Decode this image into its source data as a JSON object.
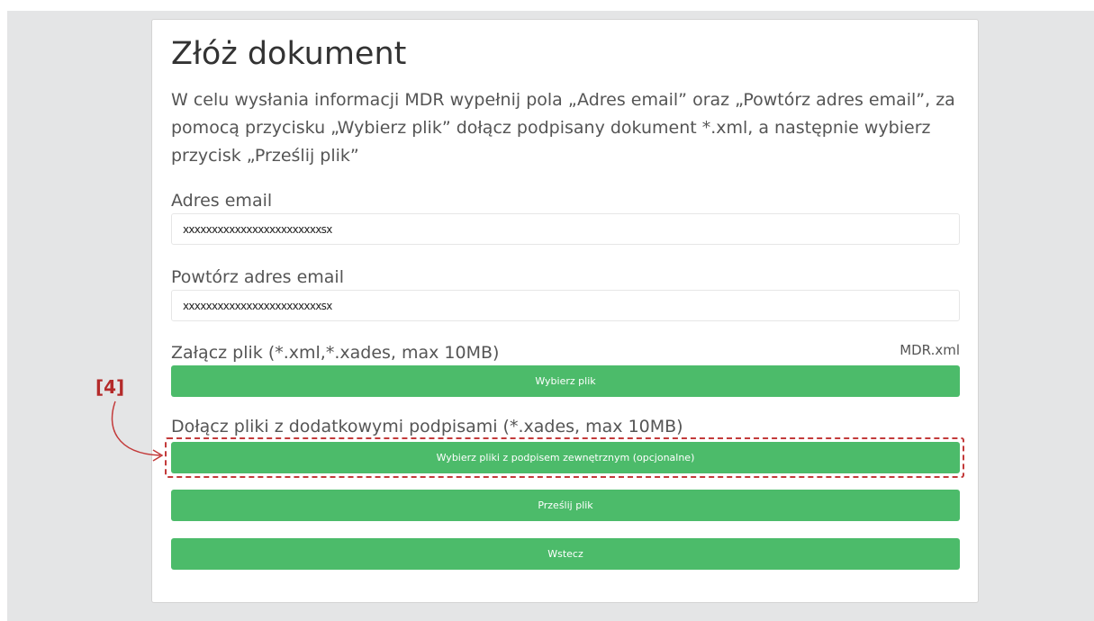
{
  "form": {
    "title": "Złóż dokument",
    "intro": "W celu wysłania informacji MDR wypełnij pola „Adres email” oraz „Powtórz adres email”, za pomocą przycisku „Wybierz plik” dołącz podpisany dokument *.xml, a następnie wybierz przycisk „Prześlij plik”",
    "email_label": "Adres email",
    "email_value": "xxxxxxxxxxxxxxxxxxxxxxxxsx",
    "repeat_email_label": "Powtórz adres email",
    "repeat_email_value": "xxxxxxxxxxxxxxxxxxxxxxxxsx",
    "attach_label": "Załącz plik (*.xml,*.xades, max 10MB)",
    "attached_file_name": "MDR.xml",
    "choose_file_button": "Wybierz plik",
    "extra_signatures_label": "Dołącz pliki z dodatkowymi podpisami (*.xades, max 10MB)",
    "choose_signed_files_button": "Wybierz pliki z podpisem zewnętrznym (opcjonalne)",
    "send_button": "Prześlij plik",
    "back_button": "Wstecz"
  },
  "annotation": {
    "marker": "[4]",
    "color": "#c33a3a"
  },
  "colors": {
    "button": "#4cbb6a",
    "background": "#e4e5e6"
  }
}
